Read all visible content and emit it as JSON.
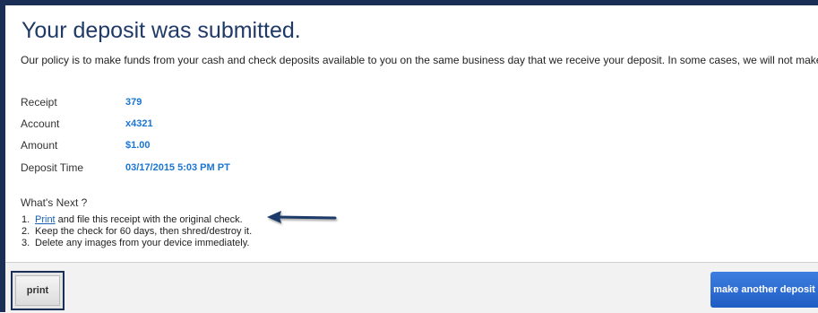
{
  "page": {
    "title": "Your deposit was submitted.",
    "policy_text": "Our policy is to make funds from your cash and check deposits available to you on the same business day that we receive your deposit. In some cases, we will not make"
  },
  "details": [
    {
      "label": "Receipt",
      "value": "379"
    },
    {
      "label": "Account",
      "value": "x4321"
    },
    {
      "label": "Amount",
      "value": "$1.00"
    },
    {
      "label": "Deposit Time",
      "value": "03/17/2015 5:03 PM PT"
    }
  ],
  "next": {
    "title": "What's Next ?",
    "steps": [
      {
        "num": "1.",
        "link": "Print",
        "text": " and file this receipt with the original check."
      },
      {
        "num": "2.",
        "text": "Keep the check for 60 days, then shred/destroy it."
      },
      {
        "num": "3.",
        "text": "Delete any images from your device immediately."
      }
    ]
  },
  "footer": {
    "print_label": "print",
    "deposit_label": "make another deposit"
  },
  "colors": {
    "title": "#1f3a67",
    "value": "#1a76d2",
    "frame": "#1b2f56",
    "primary_button": "#2a6bd4"
  },
  "icons": {
    "annotation": "arrow-left-icon"
  }
}
